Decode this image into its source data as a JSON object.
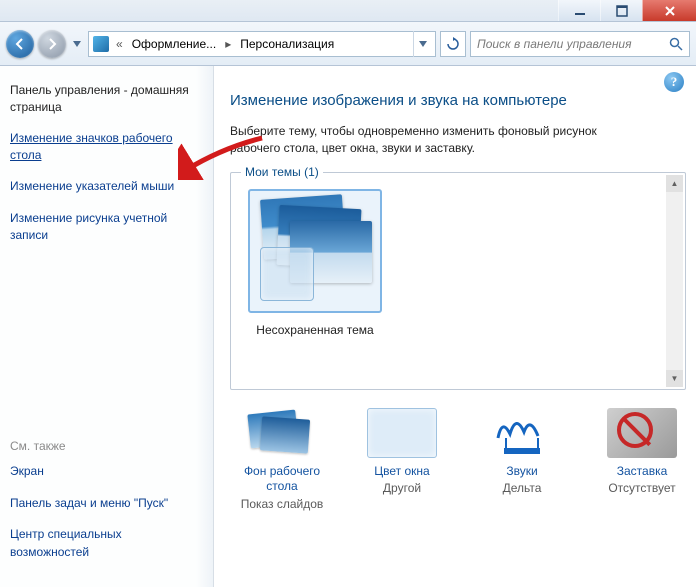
{
  "window": {
    "breadcrumb_prefix": "«",
    "breadcrumb1": "Оформление...",
    "breadcrumb2": "Персонализация",
    "search_placeholder": "Поиск в панели управления"
  },
  "sidebar": {
    "home": "Панель управления - домашняя страница",
    "links": [
      "Изменение значков рабочего стола",
      "Изменение указателей мыши",
      "Изменение рисунка учетной записи"
    ],
    "seealso": "См. также",
    "bottom_links": [
      "Экран",
      "Панель задач и меню \"Пуск\"",
      "Центр специальных возможностей"
    ]
  },
  "content": {
    "heading": "Изменение изображения и звука на компьютере",
    "description": "Выберите тему, чтобы одновременно изменить фоновый рисунок рабочего стола, цвет окна, звуки и заставку.",
    "themes_label": "Мои темы (1)",
    "theme_name": "Несохраненная тема"
  },
  "bottom": {
    "wallpaper": {
      "label": "Фон рабочего стола",
      "sub": "Показ слайдов"
    },
    "color": {
      "label": "Цвет окна",
      "sub": "Другой"
    },
    "sounds": {
      "label": "Звуки",
      "sub": "Дельта"
    },
    "screensaver": {
      "label": "Заставка",
      "sub": "Отсутствует"
    }
  }
}
